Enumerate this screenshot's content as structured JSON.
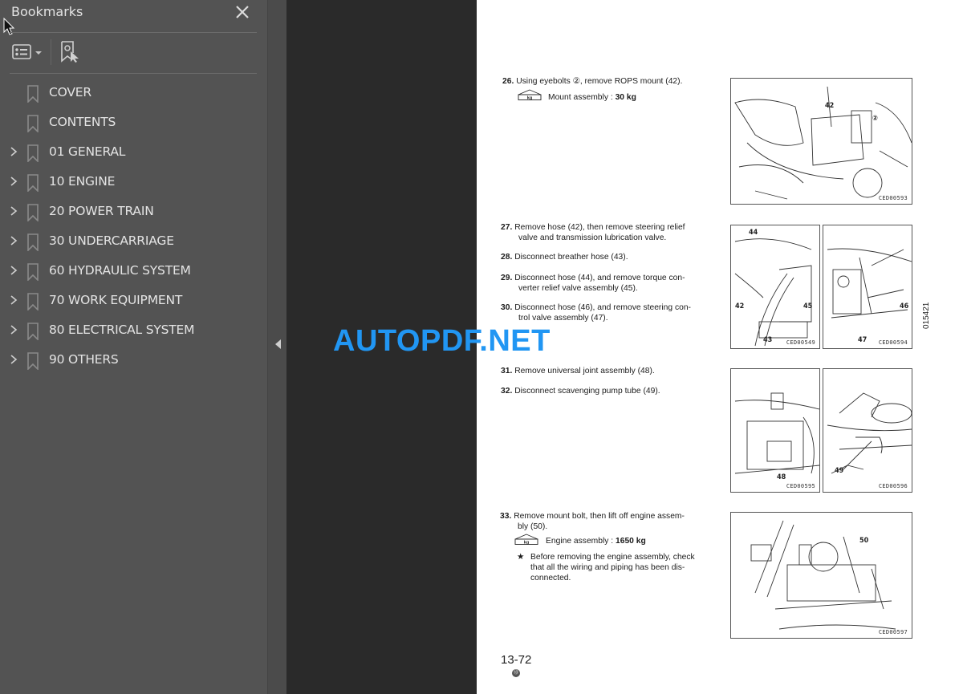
{
  "panel": {
    "title": "Bookmarks",
    "close_icon": "close-icon",
    "toolbar": {
      "options_icon": "list-options-icon",
      "dropdown_icon": "caret-down-icon",
      "find_icon": "find-current-bookmark-icon"
    },
    "items": [
      {
        "label": "COVER",
        "expandable": false
      },
      {
        "label": "CONTENTS",
        "expandable": false
      },
      {
        "label": "01 GENERAL",
        "expandable": true
      },
      {
        "label": "10 ENGINE",
        "expandable": true
      },
      {
        "label": "20 POWER TRAIN",
        "expandable": true
      },
      {
        "label": "30 UNDERCARRIAGE",
        "expandable": true
      },
      {
        "label": "60 HYDRAULIC SYSTEM",
        "expandable": true
      },
      {
        "label": "70 WORK EQUIPMENT",
        "expandable": true
      },
      {
        "label": "80 ELECTRICAL SYSTEM",
        "expandable": true
      },
      {
        "label": "90 OTHERS",
        "expandable": true
      }
    ]
  },
  "splitter": {
    "collapse_icon": "triangle-left-icon"
  },
  "watermark": "AUTOPDF.NET",
  "document": {
    "steps": [
      {
        "num": "26.",
        "line1": "Using eyebolts ②, remove ROPS mount (42).",
        "line2": ""
      },
      {
        "num": "27.",
        "line1": "Remove hose (42), then remove steering relief",
        "line2": "valve and transmission lubrication valve."
      },
      {
        "num": "28.",
        "line1": "Disconnect breather hose (43).",
        "line2": ""
      },
      {
        "num": "29.",
        "line1": "Disconnect hose (44), and remove torque con-",
        "line2": "verter relief valve assembly (45)."
      },
      {
        "num": "30.",
        "line1": "Disconnect hose (46), and remove steering con-",
        "line2": "trol valve assembly (47)."
      },
      {
        "num": "31.",
        "line1": "Remove universal joint assembly (48).",
        "line2": ""
      },
      {
        "num": "32.",
        "line1": "Disconnect scavenging pump tube (49).",
        "line2": ""
      },
      {
        "num": "33.",
        "line1": "Remove mount bolt, then lift off engine assem-",
        "line2": "bly (50)."
      }
    ],
    "weights": [
      {
        "icon_label": "kg",
        "label": "Mount assembly : ",
        "value": "30 kg"
      },
      {
        "icon_label": "kg",
        "label": "Engine assembly : ",
        "value": "1650 kg"
      }
    ],
    "note": {
      "symbol": "★",
      "lines": [
        "Before removing the engine assembly, check",
        "that all the wiring and piping has been dis-",
        "connected."
      ]
    },
    "figures": [
      {
        "code": "CED00593",
        "callouts": [
          "42",
          "②"
        ]
      },
      {
        "code": "CED00549",
        "callouts": [
          "44",
          "42",
          "45",
          "43"
        ]
      },
      {
        "code": "CED00594",
        "callouts": [
          "46",
          "47"
        ]
      },
      {
        "code": "CED00595",
        "callouts": [
          "48"
        ]
      },
      {
        "code": "CED00596",
        "callouts": [
          "49"
        ]
      },
      {
        "code": "CED00597",
        "callouts": [
          "50"
        ]
      }
    ],
    "side_code": "015421",
    "page_number": "13-72",
    "page_mark": "⑬"
  }
}
